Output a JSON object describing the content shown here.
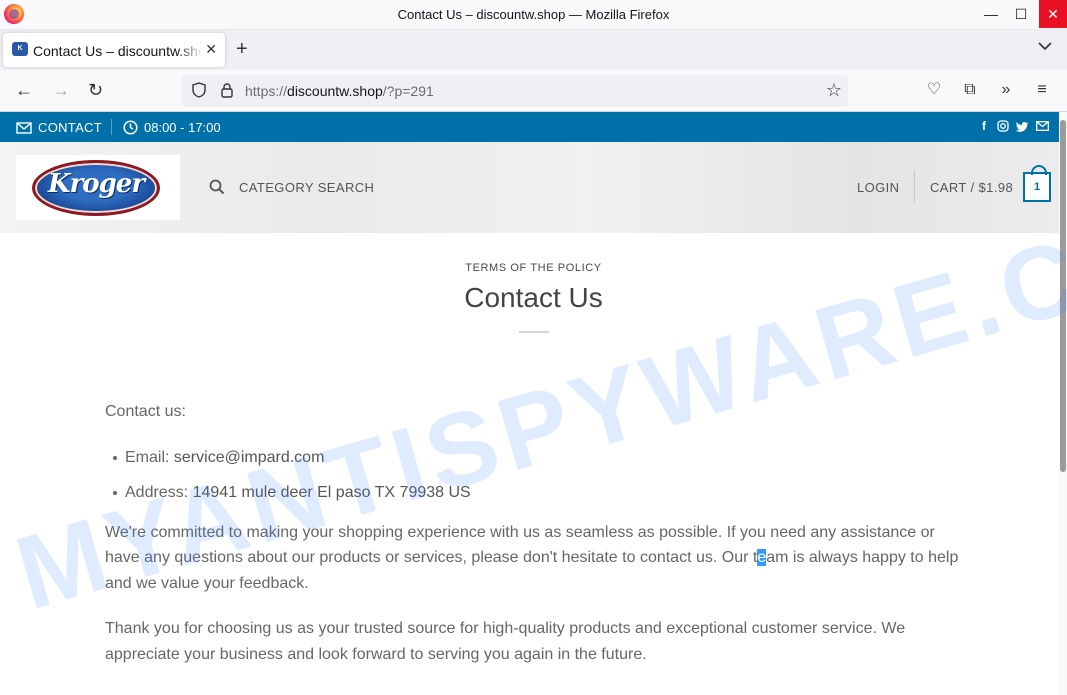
{
  "window": {
    "title": "Contact Us – discountw.shop — Mozilla Firefox",
    "minimize": "—",
    "maximize": "☐",
    "close": "✕"
  },
  "tabs": [
    {
      "label": "Contact Us – discountw.shop",
      "active": true
    }
  ],
  "tabbar": {
    "new_tab": "+",
    "list_tabs": "∨"
  },
  "navbar": {
    "back": "←",
    "forward": "→",
    "reload": "↻",
    "url_scheme": "https://",
    "url_host": "discountw.shop",
    "url_path": "/?p=291",
    "bookmark": "☆",
    "pocket": "♡",
    "extensions": "⧉",
    "overflow": "»",
    "menu": "≡"
  },
  "site": {
    "topbar": {
      "contact_label": "CONTACT",
      "hours": "08:00 - 17:00",
      "socials": [
        "facebook-icon",
        "instagram-icon",
        "twitter-icon",
        "email-icon"
      ]
    },
    "header": {
      "logo_text": "Kroger",
      "search_label": "CATEGORY SEARCH",
      "login_label": "LOGIN",
      "cart_label": "CART / $1.98",
      "cart_count": "1"
    },
    "page": {
      "breadcrumb": "TERMS OF THE POLICY",
      "title": "Contact Us",
      "intro": "Contact us:",
      "email_label": "Email: ",
      "email_value": "service@impard.com",
      "address_label": "Address: ",
      "address_value": "14941 mule deer El paso TX 79938 US",
      "para1_before": "We're committed to making your shopping experience with us as seamless as possible. If you need any assistance or have any questions about our products or services, please don't hesitate to contact us. Our t",
      "para1_highlight": "e",
      "para1_after": "am is always happy to help and we value your feedback.",
      "para2": "Thank you for choosing us as your trusted source for high-quality products and exceptional customer service. We appreciate your business and look forward to serving you again in the future."
    }
  },
  "watermark": {
    "text": "MYANTISPYWARE.COM",
    "color": "#3b82f6"
  }
}
